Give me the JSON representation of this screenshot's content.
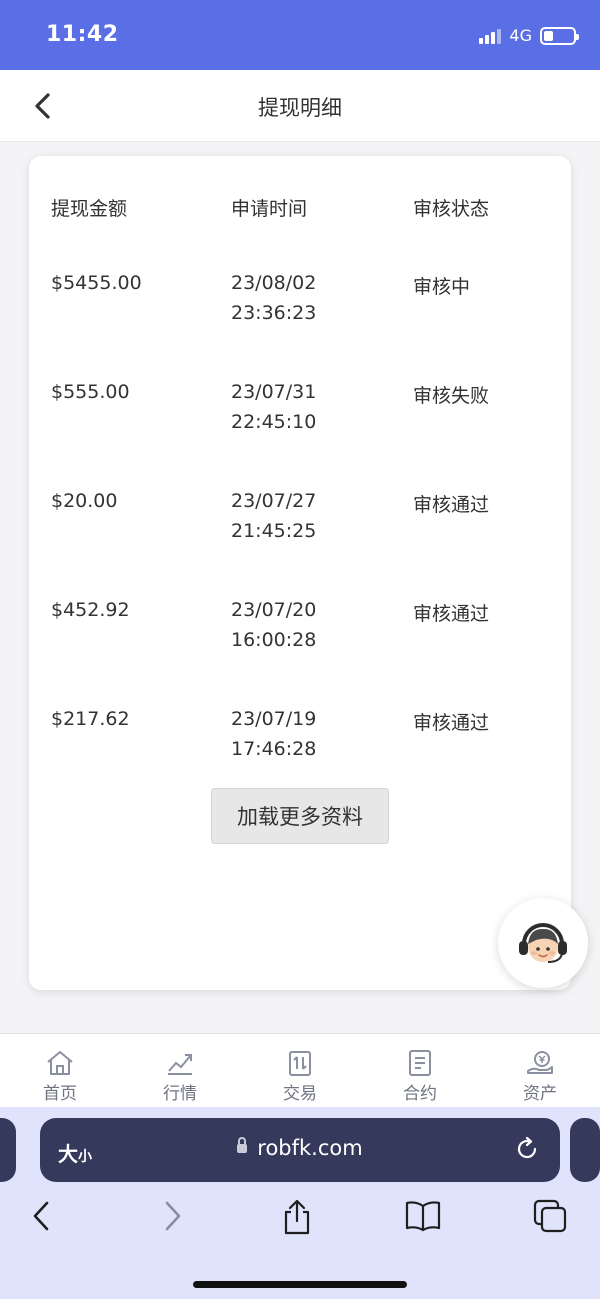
{
  "status_bar": {
    "time": "11:42",
    "network": "4G"
  },
  "nav": {
    "title": "提现明细",
    "back_icon": "chevron-left-icon"
  },
  "table": {
    "headers": [
      "提现金额",
      "申请时间",
      "审核状态"
    ],
    "rows": [
      {
        "amount": "$5455.00",
        "date": "23/08/02",
        "time": "23:36:23",
        "status": "审核中"
      },
      {
        "amount": "$555.00",
        "date": "23/07/31",
        "time": "22:45:10",
        "status": "审核失败"
      },
      {
        "amount": "$20.00",
        "date": "23/07/27",
        "time": "21:45:25",
        "status": "审核通过"
      },
      {
        "amount": "$452.92",
        "date": "23/07/20",
        "time": "16:00:28",
        "status": "审核通过"
      },
      {
        "amount": "$217.62",
        "date": "23/07/19",
        "time": "17:46:28",
        "status": "审核通过"
      }
    ]
  },
  "load_more_label": "加载更多资料",
  "customer_service_icon": "customer-service-avatar-icon",
  "tabbar": {
    "items": [
      {
        "label": "首页",
        "icon": "home-icon"
      },
      {
        "label": "行情",
        "icon": "market-chart-icon"
      },
      {
        "label": "交易",
        "icon": "trade-icon"
      },
      {
        "label": "合约",
        "icon": "contract-icon"
      },
      {
        "label": "资产",
        "icon": "assets-icon"
      }
    ]
  },
  "browser": {
    "text_size_big": "大",
    "text_size_small": "小",
    "url": "robfk.com",
    "toolbar_icons": [
      "back-icon",
      "forward-icon",
      "share-icon",
      "bookmarks-icon",
      "tabs-icon"
    ]
  },
  "colors": {
    "status_bar_bg": "#5a6fe6",
    "url_bar_bg": "#353a5c",
    "browser_bg": "#dfe3fb"
  }
}
